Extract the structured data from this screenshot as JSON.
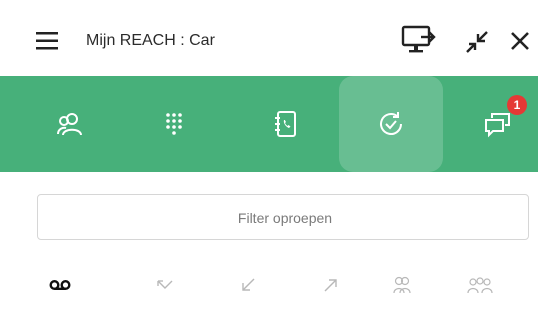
{
  "window": {
    "title": "Mijn REACH : Car"
  },
  "toolbar": {
    "menu_icon": "hamburger-icon",
    "screen_icon": "monitor-share-icon",
    "shrink_icon": "minimize-icon",
    "close_icon": "close-icon"
  },
  "nav": {
    "tabs": [
      {
        "name": "contacts",
        "icon": "contacts-icon"
      },
      {
        "name": "dialpad",
        "icon": "dialpad-icon"
      },
      {
        "name": "phonebook",
        "icon": "phonebook-icon"
      },
      {
        "name": "history",
        "icon": "call-history-icon",
        "active": true
      },
      {
        "name": "messages",
        "icon": "chat-icon",
        "badge": "1"
      }
    ]
  },
  "filter": {
    "placeholder": "Filter oproepen",
    "value": ""
  },
  "filters": [
    {
      "name": "voicemail",
      "icon": "voicemail-icon",
      "selected": true
    },
    {
      "name": "missed",
      "icon": "missed-call-icon"
    },
    {
      "name": "incoming",
      "icon": "incoming-call-icon"
    },
    {
      "name": "outgoing",
      "icon": "outgoing-call-icon"
    },
    {
      "name": "group",
      "icon": "group-icon"
    },
    {
      "name": "conference",
      "icon": "conference-icon"
    }
  ],
  "colors": {
    "accent": "#47b07a",
    "badge": "#e53935"
  }
}
